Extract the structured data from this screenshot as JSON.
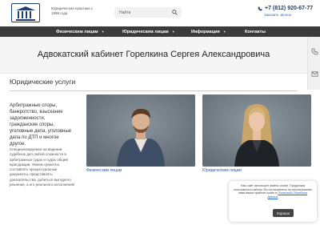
{
  "header": {
    "tagline": "Юридическая практика с 1998 года",
    "search_placeholder": "Найти",
    "phone": "+7 (812) 920-67-77",
    "callback_label": "Заказать звонок"
  },
  "nav": {
    "items": [
      {
        "label": "Физическим лицам"
      },
      {
        "label": "Юридическим лицам"
      },
      {
        "label": "Информация"
      },
      {
        "label": "Контакты"
      }
    ]
  },
  "page": {
    "title": "Адвокатский кабинет Горелкина Сергея Александровича"
  },
  "section": {
    "title": "Юридические услуги",
    "lead": "Арбитражные споры, банкротство, взыскание задолженности, гражданские споры, уголовные дела, уголовные дела по ДТП и многое другое.",
    "body": "Специализируемся на ведении судебных дел любой сложности в арбитражных судах и судах общей юрисдикции. Умеем грамотно составлять процессуальные документы, представлять доказательства, добиться выгодного решения, а его реального исполнения!",
    "cards": [
      {
        "caption": "Физическим лицам"
      },
      {
        "caption": "Юридическим лицам"
      }
    ]
  },
  "cookie": {
    "text": "Наш сайт использует файлы cookie. Продолжая пользоваться сайтом, Вы соглашаетесь на использование нами ваших файлов cookie в",
    "link": "Политикой Обработки Данных",
    "button": "Хорошо"
  },
  "colors": {
    "brand": "#1f3f72",
    "nav_bg": "#3b3b3b",
    "link": "#2a6bd1"
  }
}
